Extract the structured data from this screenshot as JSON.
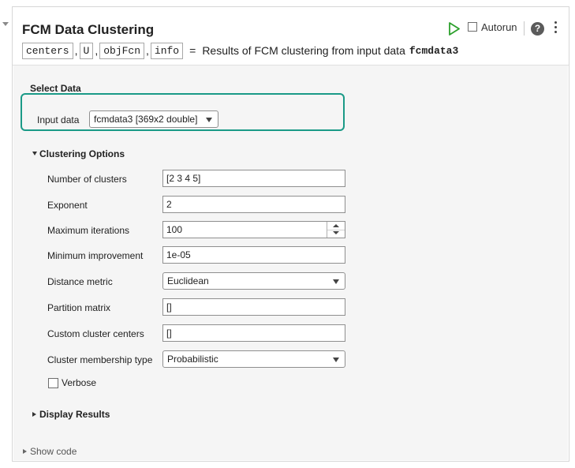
{
  "task": {
    "title": "FCM Data Clustering",
    "autorun_label": "Autorun",
    "help_glyph": "?",
    "code": {
      "outputs": [
        "centers",
        "U",
        "objFcn",
        "info"
      ],
      "separator": ",",
      "equals": "=",
      "description": "Results of FCM clustering from input data",
      "data_var": "fcmdata3"
    }
  },
  "select_data": {
    "title": "Select Data",
    "input_label": "Input data",
    "input_value": "fcmdata3 [369x2 double]"
  },
  "clustering_options": {
    "title": "Clustering Options",
    "num_clusters_label": "Number of clusters",
    "num_clusters_value": "[2 3 4 5]",
    "exponent_label": "Exponent",
    "exponent_value": "2",
    "max_iter_label": "Maximum iterations",
    "max_iter_value": "100",
    "min_improve_label": "Minimum improvement",
    "min_improve_value": "1e-05",
    "distance_label": "Distance metric",
    "distance_value": "Euclidean",
    "partition_label": "Partition matrix",
    "partition_value": "[]",
    "custom_centers_label": "Custom cluster centers",
    "custom_centers_value": "[]",
    "membership_label": "Cluster membership type",
    "membership_value": "Probabilistic",
    "verbose_label": "Verbose"
  },
  "display_results": {
    "title": "Display Results"
  },
  "show_code": {
    "label": "Show code"
  },
  "colors": {
    "highlight": "#1a9a87",
    "run": "#2ca02c"
  }
}
